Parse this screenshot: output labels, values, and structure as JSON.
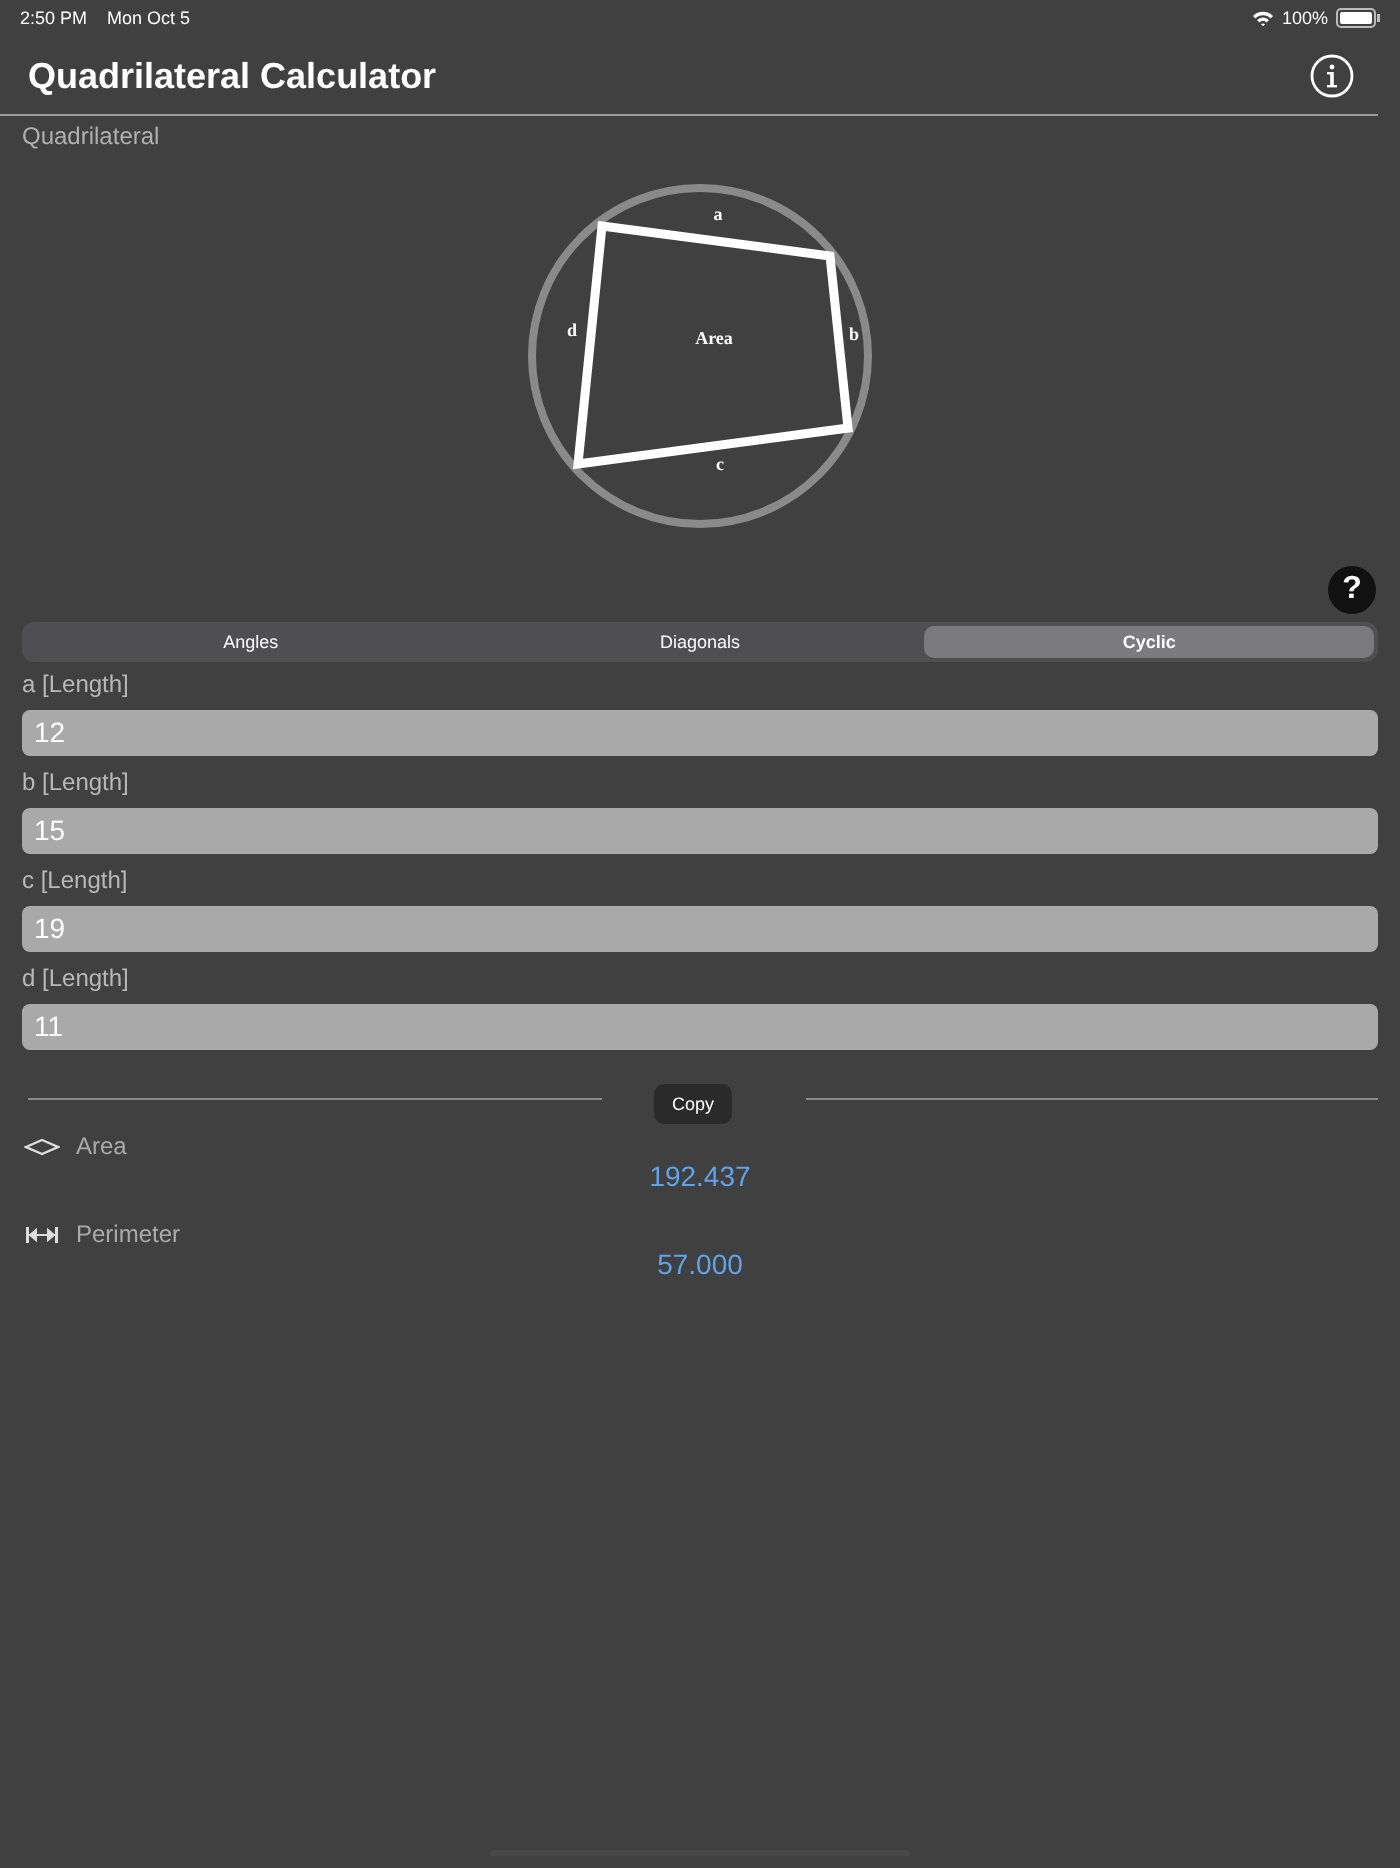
{
  "status_bar": {
    "time": "2:50 PM",
    "date": "Mon Oct 5",
    "battery": "100%"
  },
  "title": "Quadrilateral Calculator",
  "section": "Quadrilateral",
  "diagram": {
    "labels": [
      {
        "kind": "a",
        "text": "a"
      },
      {
        "kind": "b",
        "text": "b"
      },
      {
        "kind": "c",
        "text": "c"
      },
      {
        "kind": "d",
        "text": "d"
      },
      {
        "kind": "area",
        "text": "Area"
      }
    ]
  },
  "help": "?",
  "tabs": [
    {
      "label": "Angles",
      "selected": false
    },
    {
      "label": "Diagonals",
      "selected": false
    },
    {
      "label": "Cyclic",
      "selected": true
    }
  ],
  "fields": [
    {
      "label": "a [Length]",
      "value": "12"
    },
    {
      "label": "b [Length]",
      "value": "15"
    },
    {
      "label": "c [Length]",
      "value": "19"
    },
    {
      "label": "d [Length]",
      "value": "11"
    }
  ],
  "tooltip": "Copy",
  "results": [
    {
      "kind": "area",
      "label": "Area",
      "value": "192.437"
    },
    {
      "kind": "perimeter",
      "label": "Perimeter",
      "value": "57.000"
    }
  ]
}
